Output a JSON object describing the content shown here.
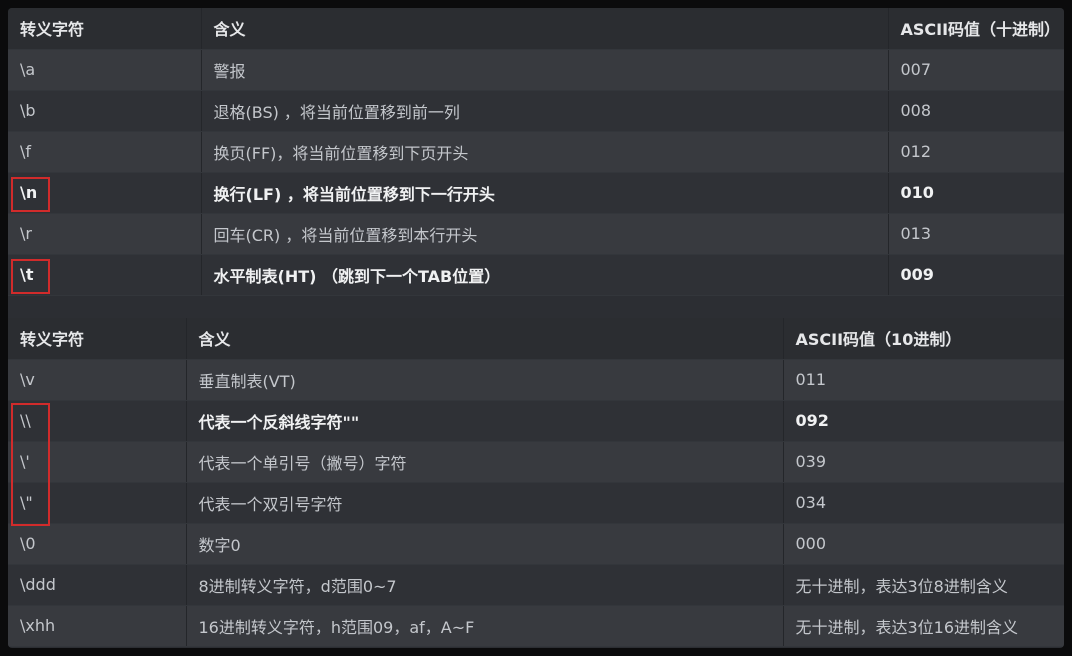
{
  "table1": {
    "headers": [
      "转义字符",
      "含义",
      "ASCII码值（十进制）"
    ],
    "rows": [
      [
        "\\a",
        "警报",
        "007"
      ],
      [
        "\\b",
        "退格(BS) ，将当前位置移到前一列",
        "008"
      ],
      [
        "\\f",
        "换页(FF)，将当前位置移到下页开头",
        "012"
      ],
      [
        "\\n",
        "换行(LF) ，将当前位置移到下一行开头",
        "010"
      ],
      [
        "\\r",
        "回车(CR) ，将当前位置移到本行开头",
        "013"
      ],
      [
        "\\t",
        "水平制表(HT) （跳到下一个TAB位置）",
        "009"
      ]
    ]
  },
  "table2": {
    "headers": [
      "转义字符",
      "含义",
      "ASCII码值（10进制）"
    ],
    "rows": [
      [
        "\\v",
        "垂直制表(VT)",
        "011"
      ],
      [
        "\\\\",
        "代表一个反斜线字符\"\"",
        "092"
      ],
      [
        "\\'",
        "代表一个单引号（撇号）字符",
        "039"
      ],
      [
        "\\\"",
        "代表一个双引号字符",
        "034"
      ],
      [
        "\\0",
        "数字0",
        "000"
      ],
      [
        "\\ddd",
        "8进制转义字符，d范围0~7",
        "无十进制，表达3位8进制含义"
      ],
      [
        "\\xhh",
        "16进制转义字符，h范围09，af，A~F",
        "无十进制，表达3位16进制含义"
      ]
    ]
  },
  "highlight_color": "#d12b2b"
}
